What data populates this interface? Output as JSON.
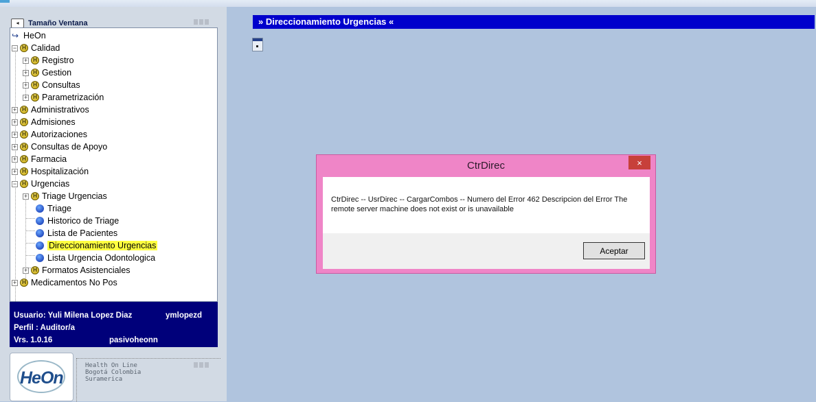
{
  "left_panel": {
    "header_label": "Tamaño Ventana",
    "tree": {
      "root": "HeOn",
      "calidad": "Calidad",
      "registro": "Registro",
      "gestion": "Gestion",
      "consultas": "Consultas",
      "parametrizacion": "Parametrización",
      "administrativos": "Administrativos",
      "admisiones": "Admisiones",
      "autorizaciones": "Autorizaciones",
      "consultas_apoyo": "Consultas de Apoyo",
      "farmacia": "Farmacia",
      "hospitalizacion": "Hospitalización",
      "urgencias": "Urgencias",
      "triage_urgencias": "Triage Urgencias",
      "triage": "Triage",
      "historico_triage": "Historico de Triage",
      "lista_pacientes": "Lista de Pacientes",
      "direccionamiento": "Direccionamiento Urgencias",
      "lista_odontologica": "Lista Urgencia Odontologica",
      "formatos": "Formatos Asistenciales",
      "medicamentos": "Medicamentos No Pos"
    },
    "user": {
      "usuario": "Usuario: Yuli Milena Lopez Diaz",
      "login": "ymlopezd",
      "perfil": "Perfil   : Auditor/a",
      "version": "Vrs. 1.0.16",
      "server": "pasivoheonn"
    },
    "logo": {
      "text": "HeOn",
      "line1": "Health On Line",
      "line2": "Bogotá Colombia",
      "line3": "Suramerica"
    }
  },
  "main": {
    "title": "» Direccionamiento Urgencias «"
  },
  "dialog": {
    "title": "CtrDirec",
    "close": "×",
    "message": "CtrDirec -- UsrDirec --  CargarCombos --  Numero del Error  462  Descripcion del Error  The remote server machine does not exist or is unavailable",
    "ok_label": "Aceptar"
  },
  "colors": {
    "title_bar": "#0000cc",
    "dialog_frame": "#ef85c7",
    "selected_highlight": "#ffff40",
    "user_box": "#00007a"
  }
}
